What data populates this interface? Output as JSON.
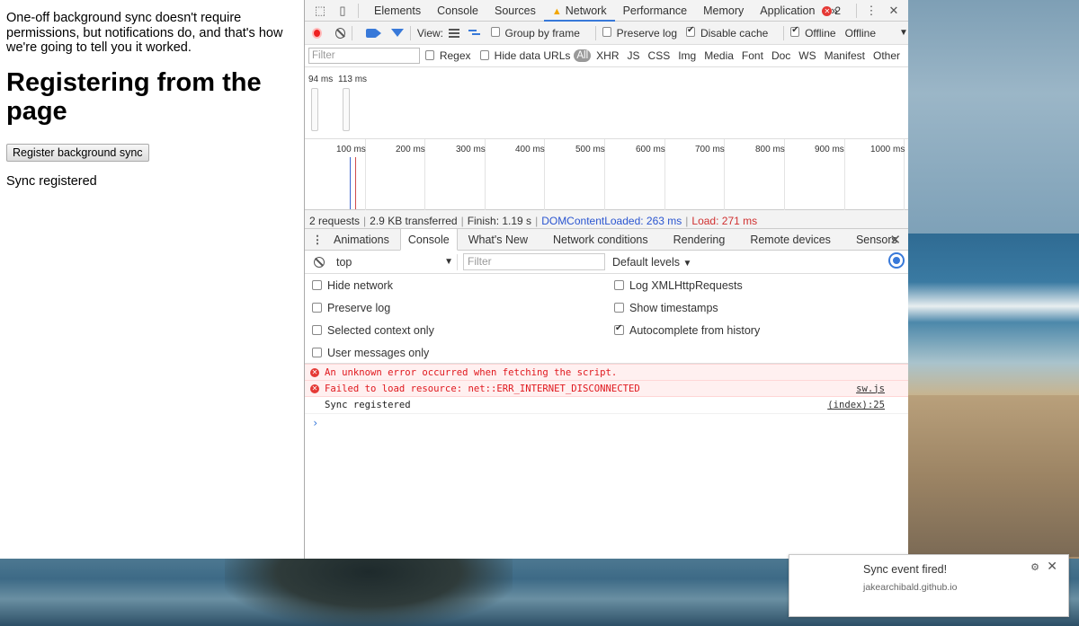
{
  "page": {
    "intro": "One-off background sync doesn't require permissions, but notifications do, and that's how we're going to tell you it worked.",
    "heading": "Registering from the page",
    "button_label": "Register background sync",
    "status": "Sync registered"
  },
  "devtools": {
    "tabs": [
      "Elements",
      "Console",
      "Sources",
      "Network",
      "Performance",
      "Memory",
      "Application"
    ],
    "active_tab": "Network",
    "more_tabs": "»",
    "error_count": "2",
    "network_toolbar": {
      "view_label": "View:",
      "group_by_frame": "Group by frame",
      "preserve_log": "Preserve log",
      "disable_cache": "Disable cache",
      "offline_checkbox": "Offline",
      "throttle_value": "Offline"
    },
    "filter_bar": {
      "placeholder": "Filter",
      "regex": "Regex",
      "hide_data_urls": "Hide data URLs",
      "types": [
        "All",
        "XHR",
        "JS",
        "CSS",
        "Img",
        "Media",
        "Font",
        "Doc",
        "WS",
        "Manifest",
        "Other"
      ]
    },
    "overview_labels": [
      "94 ms",
      "113 ms"
    ],
    "timeline_ticks": [
      "100 ms",
      "200 ms",
      "300 ms",
      "400 ms",
      "500 ms",
      "600 ms",
      "700 ms",
      "800 ms",
      "900 ms",
      "1000 ms"
    ],
    "summary": {
      "requests": "2 requests",
      "transferred": "2.9 KB transferred",
      "finish": "Finish: 1.19 s",
      "dcl": "DOMContentLoaded: 263 ms",
      "load": "Load: 271 ms"
    },
    "drawer": {
      "tabs": [
        "Animations",
        "Console",
        "What's New",
        "Network conditions",
        "Rendering",
        "Remote devices",
        "Sensors"
      ],
      "active_tab": "Console"
    },
    "console": {
      "context": "top",
      "filter_placeholder": "Filter",
      "levels": "Default levels",
      "settings_left": [
        "Hide network",
        "Preserve log",
        "Selected context only",
        "User messages only"
      ],
      "settings_right": [
        "Log XMLHttpRequests",
        "Show timestamps",
        "Autocomplete from history"
      ],
      "messages": [
        {
          "type": "error",
          "text": "An unknown error occurred when fetching the script.",
          "source": ""
        },
        {
          "type": "error",
          "text": "Failed to load resource: net::ERR_INTERNET_DISCONNECTED",
          "source": "sw.js"
        },
        {
          "type": "log",
          "text": "Sync registered",
          "source": "(index):25"
        }
      ],
      "prompt": "›"
    }
  },
  "notification": {
    "title": "Sync event fired!",
    "origin": "jakearchibald.github.io"
  }
}
